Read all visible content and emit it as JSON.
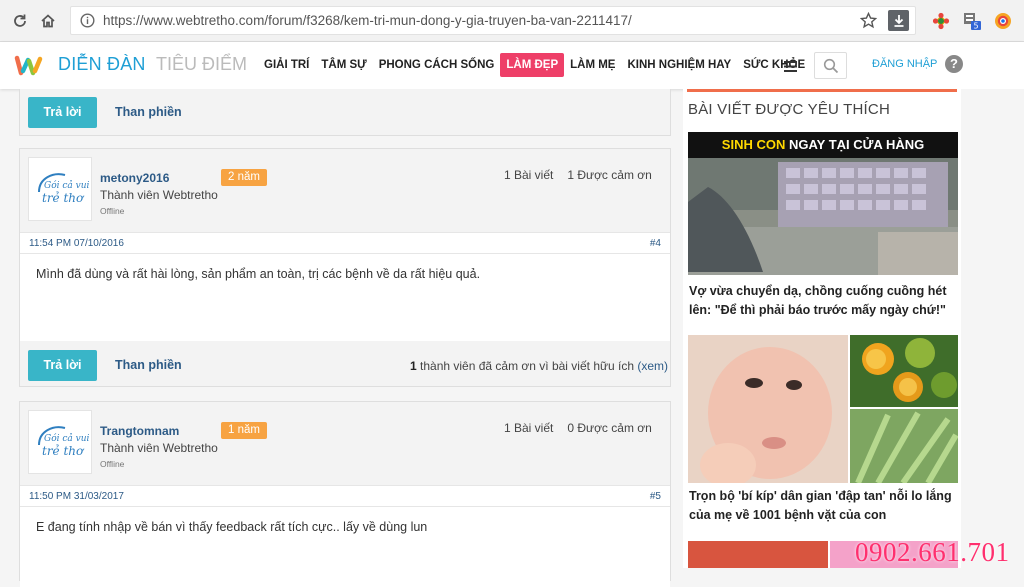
{
  "browser": {
    "url": "https://www.webtretho.com/forum/f3268/kem-tri-mun-dong-y-gia-truyen-ba-van-2211417/",
    "ext_badge": "5"
  },
  "header": {
    "brand": "DIỄN ĐÀN",
    "brand2": "TIÊU ĐIỂM",
    "menu": [
      "GIẢI TRÍ",
      "TÂM SỰ",
      "PHONG CÁCH SỐNG",
      "LÀM ĐẸP",
      "LÀM MẸ",
      "KINH NGHIỆM HAY",
      "SỨC KHỎE"
    ],
    "login": "ĐĂNG NHẬP",
    "help": "?",
    "colors": {
      "brand": "#1f9fd5",
      "active": "#ee3f68"
    }
  },
  "posts": {
    "reply_label": "Trả lời",
    "complain_label": "Than phiền",
    "items": [
      {
        "username": "metony2016",
        "badge": "2 năm",
        "role": "Thành viên Webtretho",
        "status": "Offline",
        "posts": "1 Bài viết",
        "thanks": "1 Được cảm ơn",
        "datetime": "11:54 PM 07/10/2016",
        "number": "#4",
        "content": "Mình đã dùng và rất hài lòng, sản phẩm an toàn, trị các bệnh về da rất hiệu quả."
      },
      {
        "username": "Trangtomnam",
        "badge": "1 năm",
        "role": "Thành viên Webtretho",
        "status": "Offline",
        "posts": "1 Bài viết",
        "thanks": "0 Được cảm ơn",
        "datetime": "11:50 PM 31/03/2017",
        "number": "#5",
        "content": "E đang tính nhập về bán vì thấy feedback rất tích cực.. lấy về dùng lun"
      }
    ],
    "thanks_count": "1",
    "thanks_text": " thành viên đã cảm ơn vì bài viết hữu ích ",
    "thanks_link": "(xem)"
  },
  "sidebar": {
    "title": "BÀI VIẾT ĐƯỢC YÊU THÍCH",
    "ad1_caption_a": "SINH CON",
    "ad1_caption_b": " NGAY TẠI CỬA HÀNG",
    "articles": [
      "Vợ vừa chuyển dạ, chồng cuống cuồng hét lên: \"Để thì phải báo trước mấy ngày chứ!\"",
      "Trọn bộ 'bí kíp' dân gian 'đập tan' nỗi lo lắng của mẹ về 1001 bệnh vặt của con"
    ]
  },
  "avatar_text": {
    "l1": "Gói cả vui",
    "l2": "trẻ thơ"
  },
  "overlay_phone": "0902.661.701"
}
